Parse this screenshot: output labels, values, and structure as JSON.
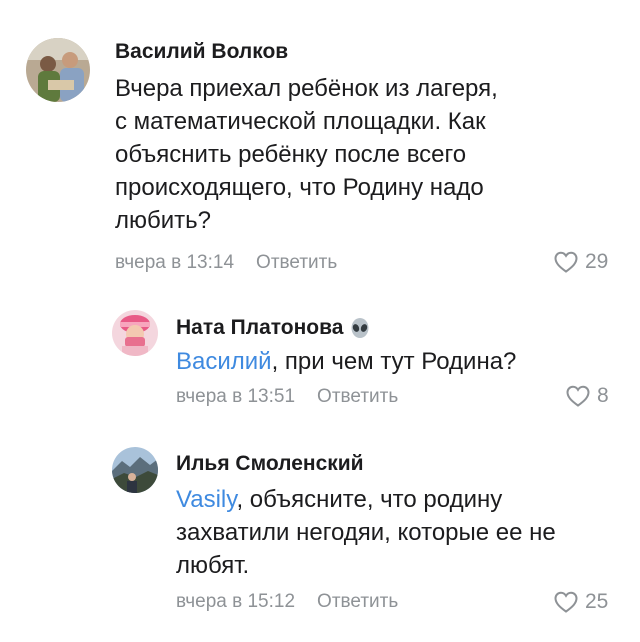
{
  "comments": [
    {
      "author": "Василий Волков",
      "text_lines": [
        "Вчера приехал ребёнок из лагеря,",
        "с математической площадки. Как",
        "объяснить ребёнку после всего",
        "происходящего, что Родину надо",
        "любить?"
      ],
      "time": "вчера в 13:14",
      "reply_label": "Ответить",
      "likes": "29"
    },
    {
      "author": "Ната Платонова",
      "author_emoji": "alien-emoji",
      "mention": "Василий",
      "text": ", при чем тут Родина?",
      "time": "вчера в 13:51",
      "reply_label": "Ответить",
      "likes": "8"
    },
    {
      "author": "Илья Смоленский",
      "mention": "Vasily",
      "text_lines": [
        ", объясните, что родину",
        "захватили негодяи, которые ее не",
        "любят."
      ],
      "time": "вчера в 15:12",
      "reply_label": "Ответить",
      "likes": "25"
    }
  ],
  "colors": {
    "mention": "#3f8ae0",
    "secondary": "#8e9296",
    "text": "#1c1c1e"
  },
  "icons": {
    "like": "heart-outline-icon"
  }
}
